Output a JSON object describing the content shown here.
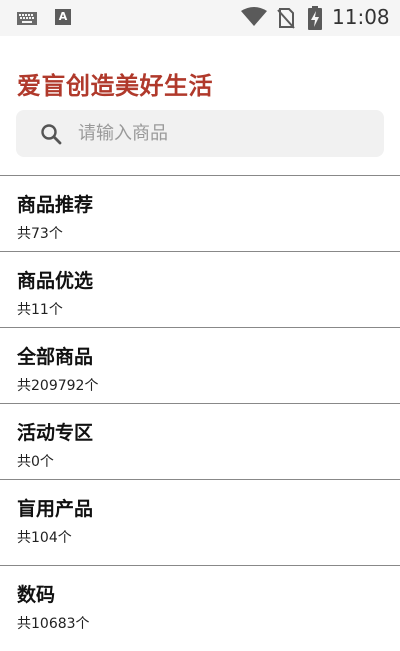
{
  "status_bar": {
    "time": "11:08",
    "app_badge": "A",
    "icons": [
      "keyboard-icon",
      "app-a-icon",
      "wifi-icon",
      "no-sim-icon",
      "battery-charging-icon"
    ]
  },
  "header": {
    "title": "爱盲创造美好生活"
  },
  "search": {
    "placeholder": "请输入商品",
    "value": ""
  },
  "categories": [
    {
      "title": "商品推荐",
      "count": "共73个"
    },
    {
      "title": "商品优选",
      "count": "共11个"
    },
    {
      "title": "全部商品",
      "count": "共209792个"
    },
    {
      "title": "活动专区",
      "count": "共0个"
    },
    {
      "title": "盲用产品",
      "count": "共104个"
    },
    {
      "title": "数码",
      "count": "共10683个"
    }
  ],
  "colors": {
    "title": "#b0392b",
    "search_bg": "#f1f1f1",
    "status_bar_bg": "#f5f5f5",
    "divider": "#888888"
  }
}
